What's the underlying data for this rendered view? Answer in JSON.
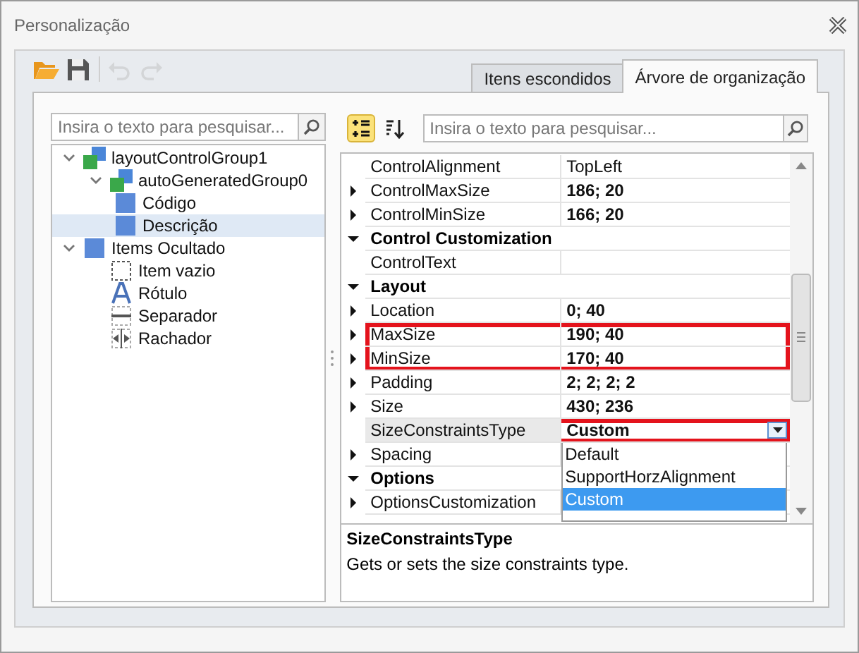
{
  "window": {
    "title": "Personalização"
  },
  "toolbar": [
    {
      "kind": "open",
      "disabled": false
    },
    {
      "kind": "save",
      "disabled": false
    },
    {
      "kind": "undo",
      "disabled": true
    },
    {
      "kind": "redo",
      "disabled": true
    }
  ],
  "tabs": [
    {
      "label": "Itens escondidos",
      "selected": false
    },
    {
      "label": "Árvore de organização",
      "selected": true
    }
  ],
  "tree": {
    "search": {
      "placeholder": "Insira o texto para pesquisar..."
    },
    "items": [
      {
        "label": "layoutControlGroup1",
        "kind": "group",
        "expanded": true,
        "selected": false,
        "children": [
          {
            "label": "autoGeneratedGroup0",
            "kind": "group",
            "expanded": true,
            "selected": false,
            "children": [
              {
                "label": "Código",
                "kind": "item",
                "selected": false
              },
              {
                "label": "Descrição",
                "kind": "item",
                "selected": true
              }
            ]
          }
        ]
      },
      {
        "label": "Items Ocultado",
        "kind": "item",
        "expanded": true,
        "selected": false,
        "children": [
          {
            "label": "Item vazio",
            "kind": "empty",
            "selected": false
          },
          {
            "label": "Rótulo",
            "kind": "label",
            "selected": false
          },
          {
            "label": "Separador",
            "kind": "separator",
            "selected": false
          },
          {
            "label": "Rachador",
            "kind": "splitter",
            "selected": false
          }
        ]
      }
    ]
  },
  "properties": {
    "view_buttons": [
      {
        "kind": "categorized",
        "selected": true
      },
      {
        "kind": "alphabetical",
        "selected": false
      }
    ],
    "search": {
      "placeholder": "Insira o texto para pesquisar..."
    },
    "rows": [
      {
        "kind": "property",
        "name": "ControlAlignment",
        "value": "TopLeft",
        "expandable": false,
        "modified": false,
        "selected": false,
        "highlighted": false
      },
      {
        "kind": "property",
        "name": "ControlMaxSize",
        "value": "186; 20",
        "expandable": true,
        "modified": true,
        "selected": false,
        "highlighted": false
      },
      {
        "kind": "property",
        "name": "ControlMinSize",
        "value": "166; 20",
        "expandable": true,
        "modified": true,
        "selected": false,
        "highlighted": false
      },
      {
        "kind": "category",
        "name": "Control Customization",
        "expanded": true
      },
      {
        "kind": "property",
        "name": "ControlText",
        "value": "",
        "expandable": false,
        "modified": false,
        "selected": false,
        "highlighted": false
      },
      {
        "kind": "category",
        "name": "Layout",
        "expanded": true
      },
      {
        "kind": "property",
        "name": "Location",
        "value": "0; 40",
        "expandable": true,
        "modified": true,
        "selected": false,
        "highlighted": false
      },
      {
        "kind": "property",
        "name": "MaxSize",
        "value": "190; 40",
        "expandable": true,
        "modified": true,
        "selected": false,
        "highlighted": true
      },
      {
        "kind": "property",
        "name": "MinSize",
        "value": "170; 40",
        "expandable": true,
        "modified": true,
        "selected": false,
        "highlighted": true
      },
      {
        "kind": "property",
        "name": "Padding",
        "value": "2; 2; 2; 2",
        "expandable": true,
        "modified": true,
        "selected": false,
        "highlighted": false
      },
      {
        "kind": "property",
        "name": "Size",
        "value": "430; 236",
        "expandable": true,
        "modified": true,
        "selected": false,
        "highlighted": false
      },
      {
        "kind": "property",
        "name": "SizeConstraintsType",
        "value": "Custom",
        "expandable": false,
        "modified": true,
        "selected": true,
        "highlighted": true
      },
      {
        "kind": "property",
        "name": "Spacing",
        "value": "",
        "expandable": true,
        "modified": false,
        "selected": false,
        "highlighted": false
      },
      {
        "kind": "category",
        "name": "Options",
        "expanded": true
      },
      {
        "kind": "property",
        "name": "OptionsCustomization",
        "value": "",
        "expandable": true,
        "modified": false,
        "selected": false,
        "highlighted": false
      }
    ],
    "dropdown": {
      "options": [
        {
          "label": "Default",
          "selected": false
        },
        {
          "label": "SupportHorzAlignment",
          "selected": false
        },
        {
          "label": "Custom",
          "selected": true
        }
      ]
    },
    "description": {
      "title": "SizeConstraintsType",
      "text": "Gets or sets the size constraints type."
    }
  }
}
